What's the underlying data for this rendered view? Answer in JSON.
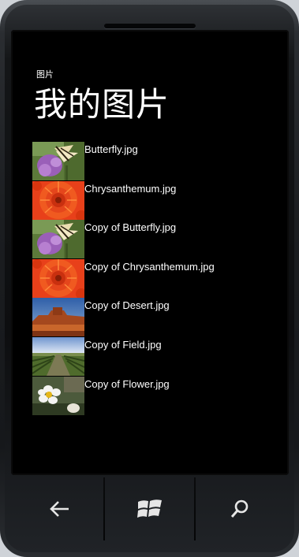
{
  "app": {
    "title": "图片",
    "page_title": "我的图片"
  },
  "photos": [
    {
      "name": "Butterfly.jpg",
      "thumb": "butterfly-thumbnail"
    },
    {
      "name": "Chrysanthemum.jpg",
      "thumb": "chrysanthemum-thumbnail"
    },
    {
      "name": "Copy of Butterfly.jpg",
      "thumb": "butterfly-thumbnail"
    },
    {
      "name": "Copy of Chrysanthemum.jpg",
      "thumb": "chrysanthemum-thumbnail"
    },
    {
      "name": "Copy of Desert.jpg",
      "thumb": "desert-thumbnail"
    },
    {
      "name": "Copy of Field.jpg",
      "thumb": "field-thumbnail"
    },
    {
      "name": "Copy of Flower.jpg",
      "thumb": "flower-thumbnail"
    }
  ],
  "hardware_buttons": [
    {
      "name": "back",
      "icon": "back-arrow-icon"
    },
    {
      "name": "start",
      "icon": "windows-logo-icon"
    },
    {
      "name": "search",
      "icon": "search-icon"
    }
  ],
  "colors": {
    "background": "#000000",
    "text": "#ffffff"
  }
}
